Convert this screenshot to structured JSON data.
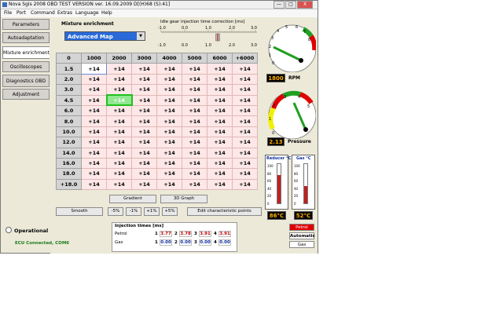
{
  "window": {
    "title": "Nova Sgis 2008 OBD TEST VERSION ver. 16.09.2009 D[(H)68 (S):41]",
    "min_label": "—",
    "max_label": "□",
    "close_label": "X"
  },
  "menu": [
    "File",
    "Port",
    "Command",
    "Extras",
    "Language",
    "Help"
  ],
  "nav": [
    {
      "label": "Parameters"
    },
    {
      "label": "Autoadaptation"
    },
    {
      "label": "Mixture enrichment"
    },
    {
      "label": "Oscilloscopes"
    },
    {
      "label": "Diagnostics OBD"
    },
    {
      "label": "Adjustment"
    }
  ],
  "mixture": {
    "group_title": "Mixture enrichment",
    "mode": "Advanced Map"
  },
  "idle_gear": {
    "title": "Idle gear injection time correction [ms]",
    "scale": [
      "-1.0",
      "0.0",
      "1.0",
      "2.0",
      "3.0"
    ],
    "scale_bottom": [
      "-1.0",
      "0.0",
      "1.0",
      "2.0",
      "3.0"
    ],
    "value": 1.4
  },
  "map": {
    "corner": "0",
    "columns": [
      "1000",
      "2000",
      "3000",
      "4000",
      "5000",
      "6000",
      "+6000"
    ],
    "rows": [
      {
        "label": "1.5",
        "values": [
          "+14",
          "+14",
          "+14",
          "+14",
          "+14",
          "+14",
          "+14"
        ]
      },
      {
        "label": "2.0",
        "values": [
          "+14",
          "+14",
          "+14",
          "+14",
          "+14",
          "+14",
          "+14"
        ]
      },
      {
        "label": "3.0",
        "values": [
          "+14",
          "+14",
          "+14",
          "+14",
          "+14",
          "+14",
          "+14"
        ]
      },
      {
        "label": "4.5",
        "values": [
          "+14",
          "+14",
          "+14",
          "+14",
          "+14",
          "+14",
          "+14"
        ]
      },
      {
        "label": "6.0",
        "values": [
          "+14",
          "+14",
          "+14",
          "+14",
          "+14",
          "+14",
          "+14"
        ]
      },
      {
        "label": "8.0",
        "values": [
          "+14",
          "+14",
          "+14",
          "+14",
          "+14",
          "+14",
          "+14"
        ]
      },
      {
        "label": "10.0",
        "values": [
          "+14",
          "+14",
          "+14",
          "+14",
          "+14",
          "+14",
          "+14"
        ]
      },
      {
        "label": "12.0",
        "values": [
          "+14",
          "+14",
          "+14",
          "+14",
          "+14",
          "+14",
          "+14"
        ]
      },
      {
        "label": "14.0",
        "values": [
          "+14",
          "+14",
          "+14",
          "+14",
          "+14",
          "+14",
          "+14"
        ]
      },
      {
        "label": "16.0",
        "values": [
          "+14",
          "+14",
          "+14",
          "+14",
          "+14",
          "+14",
          "+14"
        ]
      },
      {
        "label": "18.0",
        "values": [
          "+14",
          "+14",
          "+14",
          "+14",
          "+14",
          "+14",
          "+14"
        ]
      },
      {
        "label": "+18.0",
        "values": [
          "+14",
          "+14",
          "+14",
          "+14",
          "+14",
          "+14",
          "+14"
        ]
      }
    ]
  },
  "buttons": {
    "gradient": "Gradient",
    "graph3d": "3D Graph",
    "smooth": "Smooth",
    "m5": "-5%",
    "m1": "-1%",
    "p1": "+1%",
    "p5": "+5%",
    "edit": "Edit characteristic points"
  },
  "status": {
    "operational": "Operational",
    "ecu": "ECU Connected, COM6"
  },
  "injection": {
    "title": "Injection times [ms]",
    "petrol_label": "Petrol",
    "gas_label": "Gas",
    "idx": [
      "1",
      "2",
      "3",
      "4"
    ],
    "petrol": [
      "3.77",
      "3.78",
      "3.91",
      "3.91"
    ],
    "gas": [
      "0.00",
      "0.00",
      "0.00",
      "0.00"
    ]
  },
  "rpm": {
    "value": "1800",
    "unit": "RPM",
    "ticks": [
      "0",
      "1",
      "2",
      "3",
      "4",
      "5",
      "6",
      "7",
      "8"
    ]
  },
  "pressure": {
    "value": "2.13",
    "unit": "Pressure",
    "ticks": [
      "0",
      "1",
      "2",
      "3",
      "4",
      "5"
    ]
  },
  "reducer": {
    "title": "Reducer °C",
    "value": "86°C",
    "level": 0.72,
    "ticks": [
      "100",
      "80",
      "60",
      "40",
      "20",
      "0"
    ]
  },
  "gas_temp": {
    "title": "Gas °C",
    "value": "52°C",
    "level": 0.45,
    "ticks": [
      "100",
      "80",
      "60",
      "40",
      "20",
      "0"
    ]
  },
  "fuel": {
    "petrol": "Petrol",
    "automatic": "Automatic",
    "gas": "Gas"
  },
  "colors": {
    "accent": "#2a6ad8",
    "cell_bg": "#fde7e7",
    "active_cell": "#20c020",
    "digital_text": "#ffb000",
    "petrol_btn": "#e00000"
  }
}
